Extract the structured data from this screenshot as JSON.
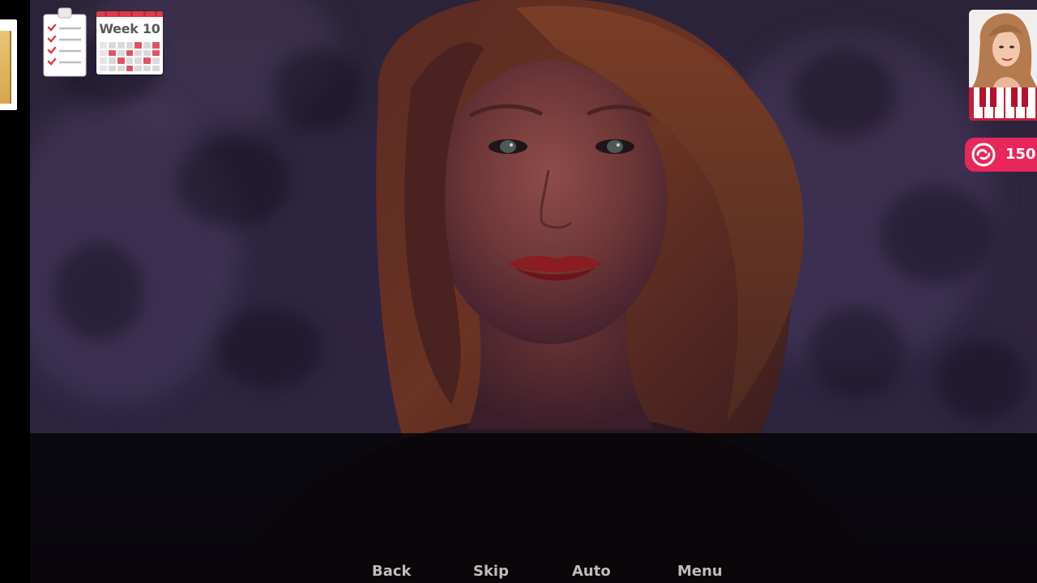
{
  "hud": {
    "calendar_label": "Week 10",
    "points_value": "150",
    "notes_icon": "notes-checklist-icon",
    "calendar_icon": "calendar-icon",
    "points_icon": "cute-points-icon",
    "portrait_icon": "character-portrait-icon"
  },
  "quick_menu": {
    "back": "Back",
    "skip": "Skip",
    "auto": "Auto",
    "menu": "Menu"
  },
  "colors": {
    "accent": "#e8265b",
    "calendar_red": "#e03a4a",
    "quick_menu_text": "#bdbdbd"
  }
}
